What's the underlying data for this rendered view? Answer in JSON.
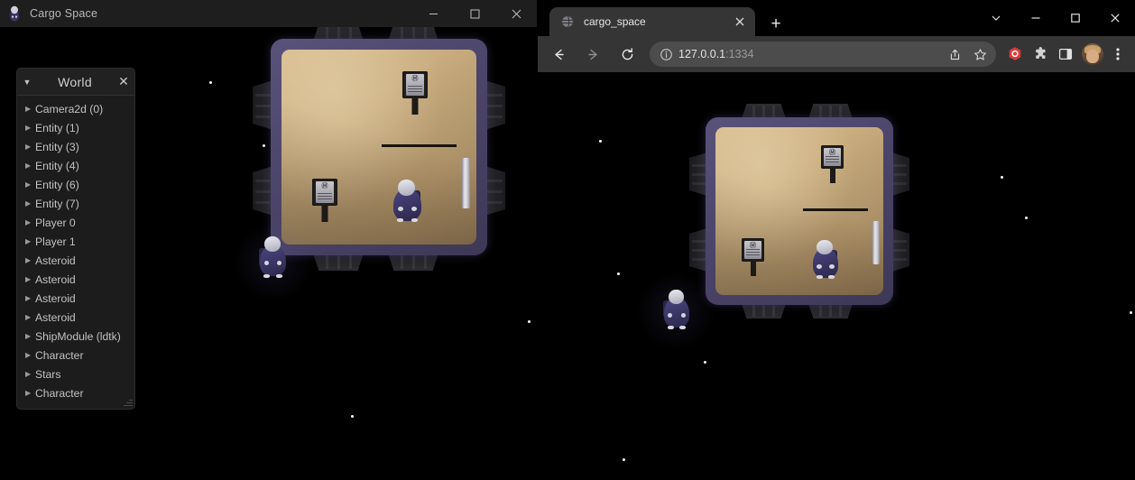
{
  "app_window": {
    "title": "Cargo Space",
    "icon": "astronaut-app-icon",
    "controls": {
      "minimize": "minimize-icon",
      "maximize": "maximize-icon",
      "close": "close-icon"
    }
  },
  "inspector": {
    "caret": "▼",
    "title": "World",
    "close": "✕",
    "arrow": "▶",
    "entities": [
      {
        "label": "Camera2d (0)"
      },
      {
        "label": "Entity (1)"
      },
      {
        "label": "Entity (3)"
      },
      {
        "label": "Entity (4)"
      },
      {
        "label": "Entity (6)"
      },
      {
        "label": "Entity (7)"
      },
      {
        "label": "Player 0"
      },
      {
        "label": "Player 1"
      },
      {
        "label": "Asteroid"
      },
      {
        "label": "Asteroid"
      },
      {
        "label": "Asteroid"
      },
      {
        "label": "Asteroid"
      },
      {
        "label": "ShipModule (ldtk)"
      },
      {
        "label": "Character"
      },
      {
        "label": "Stars"
      },
      {
        "label": "Character"
      }
    ]
  },
  "browser": {
    "tab": {
      "title": "cargo_space",
      "favicon": "globe-icon",
      "close": "✕"
    },
    "new_tab": "+",
    "window_controls": {
      "tab_search": "chevron-down-icon",
      "minimize": "minimize-icon",
      "maximize": "maximize-icon",
      "close": "close-icon"
    },
    "toolbar": {
      "back": "back-arrow-icon",
      "forward": "forward-arrow-icon",
      "reload": "reload-icon",
      "site_info": "info-icon",
      "url_host": "127.0.0.1",
      "url_port": ":1334",
      "share": "share-icon",
      "bookmark": "bookmark-star-icon",
      "extension_red": "red-extension-icon",
      "extensions": "puzzle-piece-icon",
      "side_panel": "side-panel-icon",
      "profile": "profile-avatar",
      "menu": "three-dot-menu-icon"
    }
  },
  "game": {
    "scene_name": "cargo-space-gameplay",
    "background": "#000000",
    "ship": {
      "hull_color": "#4c456a",
      "floor_color": "#c9ad7f",
      "thruster_color": "#232327",
      "module_label": "ShipModule (ldtk)"
    },
    "characters": [
      {
        "name": "player-inside-ship",
        "suit_color": "#3b3767",
        "visor_color": "#c8c8d4"
      },
      {
        "name": "player-outside-ship",
        "suit_color": "#3b3767",
        "visor_color": "#c8c8d4"
      }
    ],
    "consoles": [
      {
        "name": "console-top-right"
      },
      {
        "name": "console-bottom-left"
      }
    ],
    "star_color": "#ffffff"
  }
}
